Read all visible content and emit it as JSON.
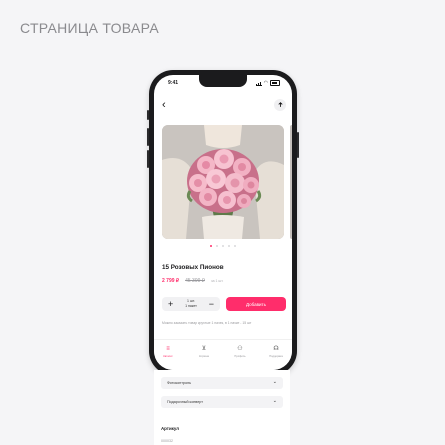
{
  "page": {
    "heading": "СТРАНИЦА ТОВАРА"
  },
  "status_bar": {
    "time": "9:41"
  },
  "nav": {
    "back_icon": "‹",
    "share_icon": "share-icon"
  },
  "product": {
    "title": "15 Розовых Пионов",
    "price_current": "2 799 ₽",
    "price_old": "45 399 ₽",
    "price_note": "за 1 шт.",
    "gallery_pages": 5,
    "gallery_active": 0
  },
  "stepper": {
    "value_line1": "1 шт.",
    "value_line2": "1 пакет",
    "plus": "+",
    "minus": "−"
  },
  "add_button": {
    "label": "Добавить"
  },
  "order_note": "Можно заказать товар круглые 1 пачек, в 1 пачке - 15 шт",
  "tabs": [
    {
      "label": "Каталог",
      "icon": "menu-icon",
      "glyph": "≡",
      "active": true
    },
    {
      "label": "Корзина",
      "icon": "cart-icon",
      "glyph": "⊻",
      "active": false
    },
    {
      "label": "Профиль",
      "icon": "user-icon",
      "glyph": "⚇",
      "active": false
    },
    {
      "label": "Поддержка",
      "icon": "support-icon",
      "glyph": "☊",
      "active": false
    }
  ],
  "details": {
    "accordions": [
      {
        "label": "Фотоконтроль"
      },
      {
        "label": "Подарочный конверт"
      }
    ],
    "article_title": "Артикул",
    "article_value": "000032"
  },
  "colors": {
    "accent": "#ff2d6b",
    "phone": "#1b1b1d",
    "background": "#f5f5f7"
  }
}
